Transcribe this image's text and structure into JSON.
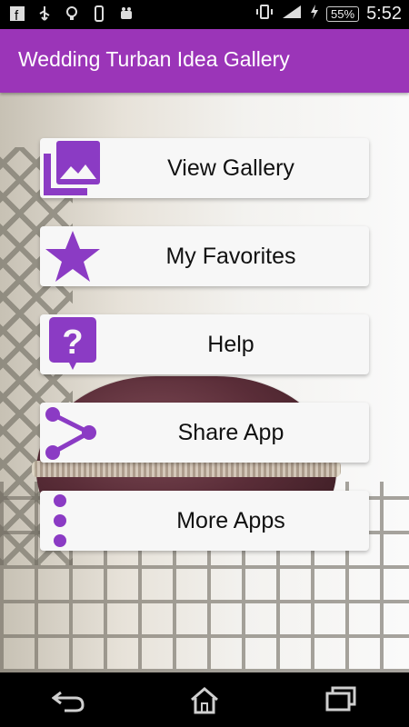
{
  "status_bar": {
    "time": "5:52",
    "battery": "55%",
    "icons": [
      "facebook-icon",
      "usb-icon",
      "bulb-icon",
      "phone-icon",
      "android-icon",
      "vibrate-icon",
      "signal-icon",
      "charging-icon"
    ]
  },
  "app": {
    "title": "Wedding Turban Idea Gallery"
  },
  "menu": [
    {
      "label": "View Gallery",
      "icon": "gallery-icon"
    },
    {
      "label": "My Favorites",
      "icon": "star-icon"
    },
    {
      "label": "Help",
      "icon": "help-icon"
    },
    {
      "label": "Share App",
      "icon": "share-icon"
    },
    {
      "label": "More Apps",
      "icon": "more-vert-icon"
    }
  ],
  "navigation": {
    "back": "back-icon",
    "home": "home-icon",
    "recents": "recents-icon"
  },
  "colors": {
    "accent": "#9b35b8",
    "icon": "#8b3bc4",
    "button_bg": "#f7f7f7"
  }
}
